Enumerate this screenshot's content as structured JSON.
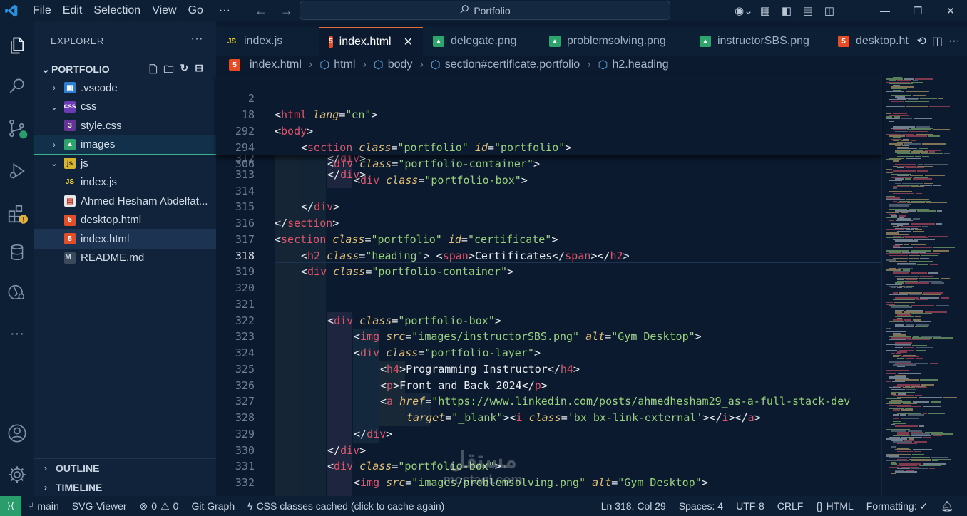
{
  "menu": [
    "File",
    "Edit",
    "Selection",
    "View",
    "Go"
  ],
  "command_center": "Portfolio",
  "sidebar": {
    "title": "EXPLORER",
    "project": "PORTFOLIO",
    "items": [
      {
        "label": ".vscode",
        "kind": "folder",
        "icon": "vscode-folder-icon",
        "depth": 1,
        "chev": "›"
      },
      {
        "label": "css",
        "kind": "folder",
        "icon": "css-folder-icon",
        "depth": 1,
        "chev": "⌄"
      },
      {
        "label": "style.css",
        "kind": "file",
        "icon": "css-file-icon",
        "depth": 2,
        "chev": ""
      },
      {
        "label": "images",
        "kind": "folder",
        "icon": "image-folder-icon",
        "depth": 1,
        "chev": "›"
      },
      {
        "label": "js",
        "kind": "folder",
        "icon": "js-folder-icon",
        "depth": 1,
        "chev": "⌄"
      },
      {
        "label": "index.js",
        "kind": "file",
        "icon": "js-file-icon",
        "depth": 2,
        "chev": ""
      },
      {
        "label": "Ahmed Hesham Abdelfat...",
        "kind": "file",
        "icon": "pdf-file-icon",
        "depth": 1,
        "chev": ""
      },
      {
        "label": "desktop.html",
        "kind": "file",
        "icon": "html-file-icon",
        "depth": 1,
        "chev": ""
      },
      {
        "label": "index.html",
        "kind": "file",
        "icon": "html-file-icon",
        "depth": 1,
        "chev": ""
      },
      {
        "label": "README.md",
        "kind": "file",
        "icon": "markdown-file-icon",
        "depth": 1,
        "chev": ""
      }
    ],
    "outline": "OUTLINE",
    "timeline": "TIMELINE"
  },
  "tabs": [
    {
      "label": "index.js",
      "icon": "js-file-icon"
    },
    {
      "label": "index.html",
      "icon": "html-file-icon"
    },
    {
      "label": "delegate.png",
      "icon": "image-file-icon"
    },
    {
      "label": "problemsolving.png",
      "icon": "image-file-icon"
    },
    {
      "label": "instructorSBS.png",
      "icon": "image-file-icon"
    },
    {
      "label": "desktop.html",
      "icon": "html-file-icon"
    }
  ],
  "breadcrumb": [
    "index.html",
    "html",
    "body",
    "section#certificate.portfolio",
    "h2.heading"
  ],
  "sticky_lines": [
    "2",
    "18",
    "292",
    "294",
    "306"
  ],
  "line_numbers": [
    "312",
    "313",
    "314",
    "315",
    "316",
    "317",
    "318",
    "319",
    "320",
    "321",
    "322",
    "323",
    "324",
    "325",
    "326",
    "327",
    "328",
    "329",
    "330",
    "331",
    "332"
  ],
  "code": {
    "l2": {
      "open": "<",
      "tag": "html",
      "attr": "lang",
      "val": "\"en\"",
      "close": ">"
    },
    "l18": {
      "open": "<",
      "tag": "body",
      "close": ">"
    },
    "l292": {
      "tag": "section",
      "a1": "class",
      "v1": "\"portfolio\"",
      "a2": "id",
      "v2": "\"portfolio\""
    },
    "l294": {
      "tag": "div",
      "a1": "class",
      "v1": "\"portfolio-container\""
    },
    "l306": {
      "tag": "div",
      "a1": "class",
      "v1": "\"portfolio-box\""
    },
    "l312": {
      "tag": "div"
    },
    "l313": {
      "tag": "div"
    },
    "l315": {
      "tag": "div"
    },
    "l316": {
      "tag": "section"
    },
    "l317": {
      "tag": "section",
      "a1": "class",
      "v1": "\"portfolio\"",
      "a2": "id",
      "v2": "\"certificate\""
    },
    "l318": {
      "tag": "h2",
      "a1": "class",
      "v1": "\"heading\"",
      "tag2": "span",
      "text": "Certificates"
    },
    "l319": {
      "tag": "div",
      "a1": "class",
      "v1": "\"portfolio-container\""
    },
    "l322": {
      "tag": "div",
      "a1": "class",
      "v1": "\"portfolio-box\""
    },
    "l323": {
      "tag": "img",
      "a1": "src",
      "v1": "\"images/instructorSBS.png\"",
      "a2": "alt",
      "v2": "\"Gym Desktop\""
    },
    "l324": {
      "tag": "div",
      "a1": "class",
      "v1": "\"portfolio-layer\""
    },
    "l325": {
      "tag": "h4",
      "text": "Programming Instructor"
    },
    "l326": {
      "tag": "p",
      "text": "Front and Back 2024"
    },
    "l327": {
      "tag": "a",
      "a1": "href",
      "v1": "\"https://www.linkedin.com/posts/ahmedhesham29_as-a-full-stack-dev"
    },
    "l328": {
      "a1": "target",
      "v1": "\"_blank\"",
      "tag": "i",
      "a2": "class",
      "v2": "'bx bx-link-external'",
      "tag2": "a"
    },
    "l329": {
      "tag": "div"
    },
    "l330": {
      "tag": "div"
    },
    "l331": {
      "tag": "div",
      "a1": "class",
      "v1": "\"portfolio-box\""
    },
    "l332": {
      "tag": "img",
      "a1": "src",
      "v1": "\"images/problemsolving.png\"",
      "a2": "alt",
      "v2": "\"Gym Desktop\""
    }
  },
  "statusbar": {
    "branch": "main",
    "svg_viewer": "SVG-Viewer",
    "errors": "0",
    "warnings": "0",
    "git_graph": "Git Graph",
    "css_cache": "CSS classes cached (click to cache again)",
    "position": "Ln 318, Col 29",
    "spaces": "Spaces: 4",
    "encoding": "UTF-8",
    "eol": "CRLF",
    "language": "HTML",
    "formatting": "Formatting: ✓"
  },
  "watermark": {
    "arabic": "مستقل",
    "latin": "mostaql.com"
  },
  "colors": {
    "accent_green": "#2b9c6b",
    "tab_active_border": "#e36c3c",
    "tag": "#e0566c",
    "attr": "#e3c078",
    "string": "#9ad27d"
  }
}
